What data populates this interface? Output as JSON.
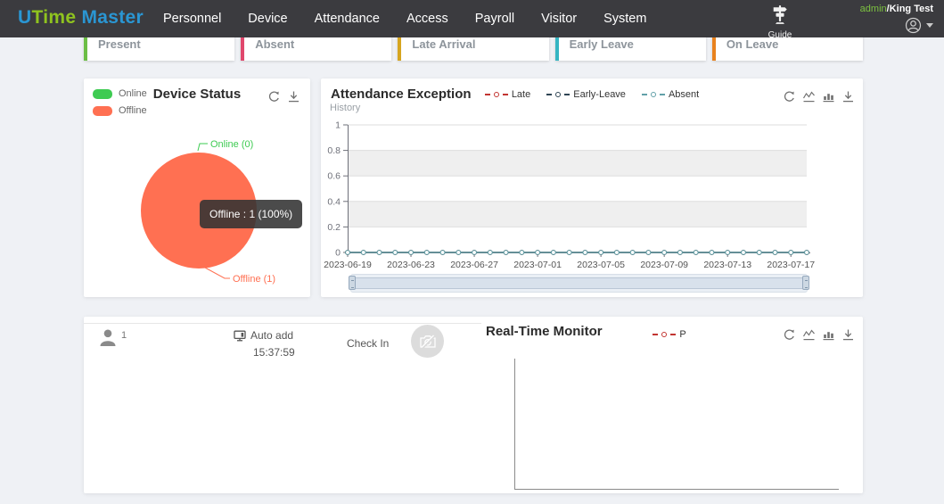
{
  "colors": {
    "page_bg": "#eff1f5",
    "navbar_bg": "#3b3b3f",
    "brand_blue": "#2a96d3",
    "brand_green": "#8fc31f",
    "admin_green": "#7cc140",
    "pie_offline": "#ff7052",
    "online_green": "#3ecb52",
    "tooltip_bg": "rgba(50,50,50,0.88)"
  },
  "navbar": {
    "logo": {
      "u": "U",
      "time": "Time",
      "master": " Master"
    },
    "items": [
      {
        "label": "Personnel"
      },
      {
        "label": "Device"
      },
      {
        "label": "Attendance"
      },
      {
        "label": "Access"
      },
      {
        "label": "Payroll"
      },
      {
        "label": "Visitor"
      },
      {
        "label": "System"
      }
    ],
    "guide_label": "Guide",
    "user": {
      "role": "admin",
      "name": "/King Test"
    }
  },
  "stat_cards": [
    {
      "label": "Present",
      "color": "#6cbe45"
    },
    {
      "label": "Absent",
      "color": "#e0476c"
    },
    {
      "label": "Late Arrival",
      "color": "#d6a520"
    },
    {
      "label": "Early Leave",
      "color": "#35b5c2"
    },
    {
      "label": "On Leave",
      "color": "#e8821e"
    }
  ],
  "device_status": {
    "title": "Device Status",
    "legend": [
      {
        "label": "Online",
        "color": "#3ecb52"
      },
      {
        "label": "Offline",
        "color": "#ff7052"
      }
    ],
    "callout_online": "Online (0)",
    "callout_offline": "Offline (1)",
    "tooltip": "Offline : 1 (100%)",
    "toolbox_icons": [
      "refresh",
      "download"
    ]
  },
  "attendance": {
    "title": "Attendance Exception",
    "axis_name": "History",
    "legend": [
      {
        "label": "Late",
        "color": "#c23531"
      },
      {
        "label": "Early-Leave",
        "color": "#2f4554"
      },
      {
        "label": "Absent",
        "color": "#61a0a8"
      }
    ],
    "toolbox_icons": [
      "refresh",
      "line-chart",
      "bar-chart",
      "download"
    ]
  },
  "realtime": {
    "title": "Real-Time Monitor",
    "legend": [
      {
        "label": "P",
        "color": "#c23531"
      }
    ],
    "record": {
      "index": "1",
      "mode": "Auto add",
      "time": "15:37:59",
      "event": "Check In"
    },
    "toolbox_icons": [
      "refresh",
      "line-chart",
      "bar-chart",
      "download"
    ]
  },
  "chart_data": [
    {
      "id": "device-status-pie",
      "type": "pie",
      "title": "Device Status",
      "slices": [
        {
          "label": "Online",
          "value": 0,
          "color": "#3ecb52"
        },
        {
          "label": "Offline",
          "value": 1,
          "color": "#ff7052",
          "percent": "100%"
        }
      ],
      "tooltip": "Offline : 1 (100%)",
      "legend_position": "top-left"
    },
    {
      "id": "attendance-exception-line",
      "type": "line",
      "title": "Attendance Exception",
      "ylabel": "History",
      "ylim": [
        0,
        1
      ],
      "yticks": [
        0,
        0.2,
        0.4,
        0.6,
        0.8,
        1
      ],
      "grid_bands": [
        [
          0.2,
          0.4
        ],
        [
          0.6,
          0.8
        ]
      ],
      "legend_position": "top-center",
      "has_datazoom_slider": true,
      "x": [
        "2023-06-19",
        "2023-06-20",
        "2023-06-21",
        "2023-06-22",
        "2023-06-23",
        "2023-06-24",
        "2023-06-25",
        "2023-06-26",
        "2023-06-27",
        "2023-06-28",
        "2023-06-29",
        "2023-06-30",
        "2023-07-01",
        "2023-07-02",
        "2023-07-03",
        "2023-07-04",
        "2023-07-05",
        "2023-07-06",
        "2023-07-07",
        "2023-07-08",
        "2023-07-09",
        "2023-07-10",
        "2023-07-11",
        "2023-07-12",
        "2023-07-13",
        "2023-07-14",
        "2023-07-15",
        "2023-07-16",
        "2023-07-17",
        "2023-07-18"
      ],
      "x_tick_indices": [
        0,
        4,
        8,
        12,
        16,
        20,
        24,
        28
      ],
      "x_tick_labels": [
        "2023-06-19",
        "2023-06-23",
        "2023-06-27",
        "2023-07-01",
        "2023-07-05",
        "2023-07-09",
        "2023-07-13",
        "2023-07-17"
      ],
      "series": [
        {
          "name": "Late",
          "color": "#c23531",
          "values": [
            0,
            0,
            0,
            0,
            0,
            0,
            0,
            0,
            0,
            0,
            0,
            0,
            0,
            0,
            0,
            0,
            0,
            0,
            0,
            0,
            0,
            0,
            0,
            0,
            0,
            0,
            0,
            0,
            0,
            0
          ]
        },
        {
          "name": "Early-Leave",
          "color": "#2f4554",
          "values": [
            0,
            0,
            0,
            0,
            0,
            0,
            0,
            0,
            0,
            0,
            0,
            0,
            0,
            0,
            0,
            0,
            0,
            0,
            0,
            0,
            0,
            0,
            0,
            0,
            0,
            0,
            0,
            0,
            0,
            0
          ]
        },
        {
          "name": "Absent",
          "color": "#61a0a8",
          "values": [
            0,
            0,
            0,
            0,
            0,
            0,
            0,
            0,
            0,
            0,
            0,
            0,
            0,
            0,
            0,
            0,
            0,
            0,
            0,
            0,
            0,
            0,
            0,
            0,
            0,
            0,
            0,
            0,
            0,
            0
          ]
        }
      ]
    },
    {
      "id": "realtime-monitor-line",
      "type": "line",
      "title": "Real-Time Monitor",
      "x": [],
      "series": [
        {
          "name": "P",
          "color": "#c23531",
          "values": []
        }
      ]
    }
  ]
}
